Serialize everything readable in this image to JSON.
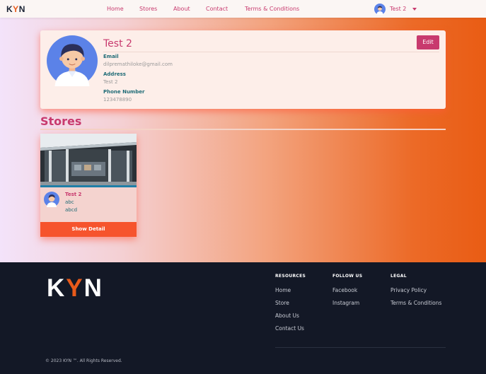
{
  "nav": {
    "logo_k": "K",
    "logo_y": "Y",
    "logo_n": "N",
    "links": [
      "Home",
      "Stores",
      "About",
      "Contact",
      "Terms & Conditions"
    ],
    "user_name": "Test 2"
  },
  "profile": {
    "name": "Test 2",
    "edit_label": "Edit",
    "email_label": "Email",
    "email": "dilpremathiloke@gmail.com",
    "address_label": "Address",
    "address": "Test 2",
    "phone_label": "Phone Number",
    "phone": "123478890"
  },
  "stores": {
    "title": "Stores",
    "items": [
      {
        "name": "Test 2",
        "line1": "abc",
        "line2": "abcd",
        "button": "Show Detail"
      }
    ]
  },
  "footer": {
    "logo_k": "K",
    "logo_y": "Y",
    "logo_n": "N",
    "resources": {
      "heading": "RESOURCES",
      "links": [
        "Home",
        "Store",
        "About Us",
        "Contact Us"
      ]
    },
    "follow": {
      "heading": "FOLLOW US",
      "links": [
        "Facebook",
        "Instagram"
      ]
    },
    "legal": {
      "heading": "LEGAL",
      "links": [
        "Privacy Policy",
        "Terms & Conditions"
      ]
    },
    "copyright": "© 2023 KYN ™. All Rights Reserved."
  },
  "colors": {
    "brand_pink": "#c83a6e",
    "brand_orange": "#e85a1a",
    "button_orange": "#f6542d",
    "teal_label": "#1f6b76",
    "footer_bg": "#131826"
  },
  "icons": [
    "user-avatar-icon",
    "chevron-down-icon",
    "store-photo"
  ]
}
